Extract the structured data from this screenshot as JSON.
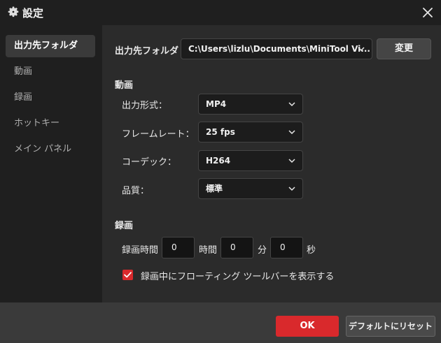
{
  "window": {
    "title": "設定"
  },
  "sidebar": {
    "items": [
      {
        "label": "出力先フォルダ"
      },
      {
        "label": "動画"
      },
      {
        "label": "録画"
      },
      {
        "label": "ホットキー"
      },
      {
        "label": "メイン パネル"
      }
    ]
  },
  "output": {
    "label": "出力先フォルダ",
    "path": "C:\\Users\\lizlu\\Documents\\MiniTool Vi...",
    "change_label": "変更"
  },
  "video": {
    "heading": "動画",
    "format_label": "出力形式：",
    "format_value": "MP4",
    "framerate_label": "フレームレート：",
    "framerate_value": "25 fps",
    "codec_label": "コーデック：",
    "codec_value": "H264",
    "quality_label": "品質：",
    "quality_value": "標準"
  },
  "recording": {
    "heading": "録画",
    "duration_label": "録画時間",
    "hours_value": "0",
    "hours_unit": "時間",
    "minutes_value": "0",
    "minutes_unit": "分",
    "seconds_value": "0",
    "seconds_unit": "秒",
    "floating_toolbar_label": "録画中にフローティング ツールバーを表示する",
    "floating_toolbar_checked": true
  },
  "footer": {
    "ok_label": "OK",
    "reset_label": "デフォルトにリセット"
  },
  "colors": {
    "accent": "#d9292c",
    "background": "#2b2b2b",
    "sidebar": "#1f1f1f"
  }
}
